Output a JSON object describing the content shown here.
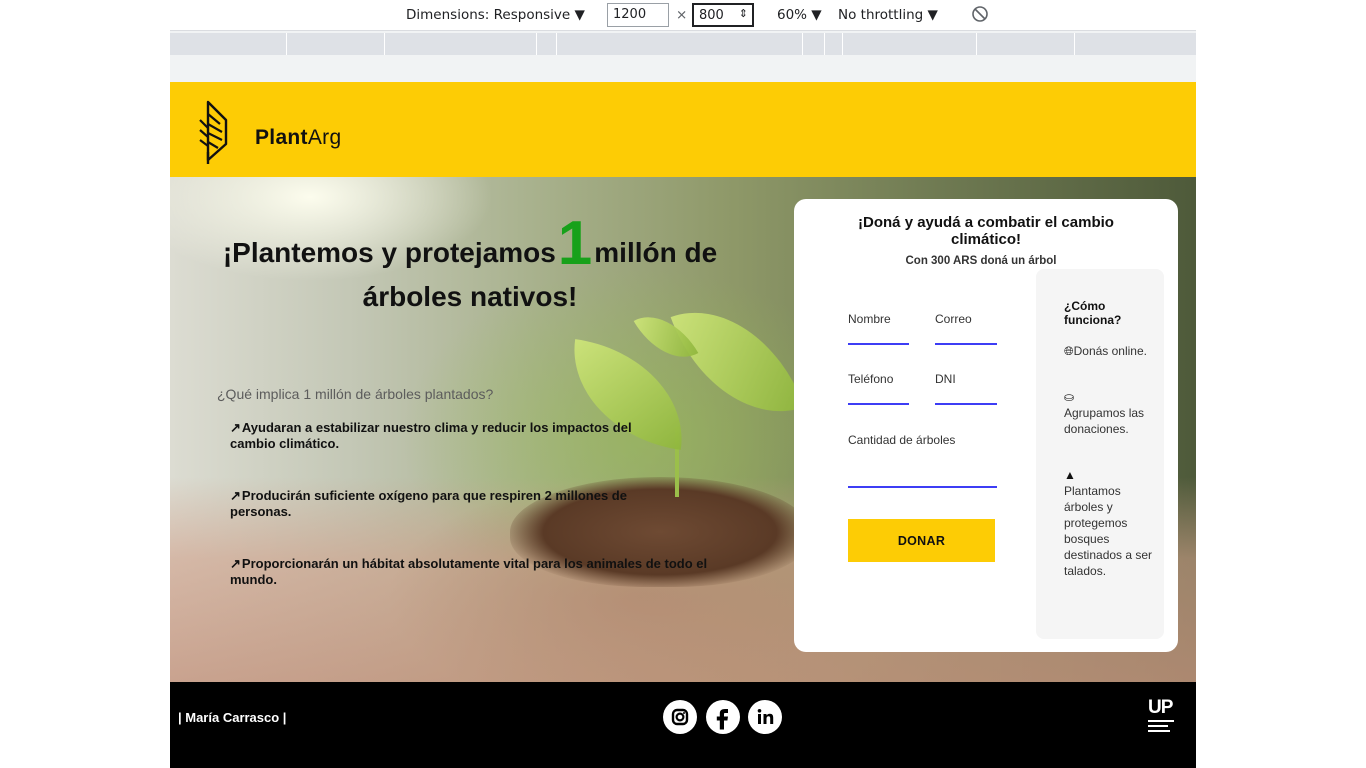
{
  "devtools": {
    "dimensions_label": "Dimensions: Responsive ▼",
    "width_value": "1200",
    "times": "×",
    "height_value": "800",
    "zoom": "60% ▼",
    "throttling": "No throttling ▼"
  },
  "brand": {
    "name_bold": "Plant",
    "name_light": "Arg",
    "accent_color": "#fdcc05",
    "highlight_color": "#17a11a"
  },
  "hero": {
    "title_before": "¡Plantemos y protejamos",
    "title_number": "1",
    "title_after": "millón de árboles nativos!",
    "question": "¿Qué implica 1 millón de árboles plantados?",
    "benefits": [
      "Ayudaran a estabilizar nuestro clima y reducir los impactos del cambio climático.",
      "Producirán suficiente oxígeno para que respiren 2 millones de personas.",
      "Proporcionarán un hábitat absolutamente vital para los animales de todo el mundo."
    ],
    "trend_icon": "trending-up-icon"
  },
  "form": {
    "title": "¡Doná y ayudá a combatir el cambio climático!",
    "subtitle": "Con 300 ARS doná un árbol",
    "fields": {
      "name": "Nombre",
      "email": "Correo",
      "phone": "Teléfono",
      "dni": "DNI",
      "trees": "Cantidad de árboles"
    },
    "submit": "DONAR"
  },
  "how_it_works": {
    "title": "¿Cómo funciona?",
    "steps": [
      {
        "icon": "globe-icon",
        "text": "Donás online."
      },
      {
        "icon": "hand-holding-icon",
        "text": "Agrupamos las donaciones."
      },
      {
        "icon": "tree-icon",
        "text": "Plantamos árboles y protegemos bosques destinados a ser talados."
      }
    ]
  },
  "footer": {
    "author": "| María Carrasco |",
    "social": [
      "instagram-icon",
      "facebook-icon",
      "linkedin-icon"
    ],
    "logo_text": "UP"
  }
}
